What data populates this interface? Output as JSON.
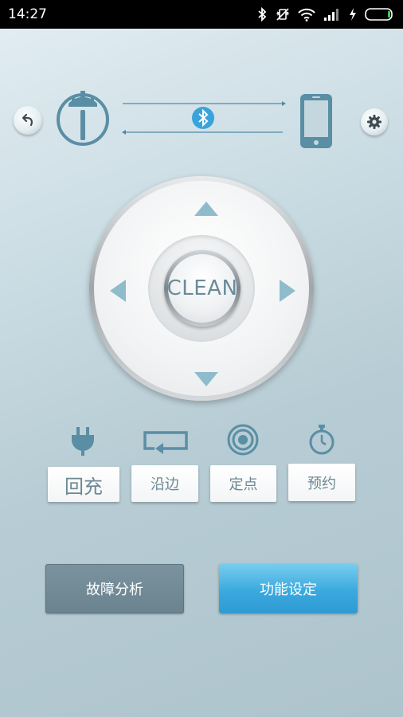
{
  "status_bar": {
    "time": "14:27",
    "icons": [
      "bluetooth-icon",
      "vibrate-icon",
      "wifi-icon",
      "signal-icon",
      "charging-icon",
      "battery-icon"
    ]
  },
  "connection": {
    "back_icon": "back-arrow-icon",
    "robot_icon": "robot-vacuum-icon",
    "link_icon": "bluetooth-icon",
    "phone_icon": "smartphone-icon",
    "settings_icon": "gear-icon"
  },
  "dpad": {
    "center_label": "CLEAN",
    "arrows": [
      "up",
      "down",
      "left",
      "right"
    ]
  },
  "modes": [
    {
      "icon": "plug-icon",
      "label": "回充"
    },
    {
      "icon": "edge-return-icon",
      "label": "沿边"
    },
    {
      "icon": "target-icon",
      "label": "定点"
    },
    {
      "icon": "stopwatch-icon",
      "label": "预约"
    }
  ],
  "actions": {
    "fault_label": "故障分析",
    "function_label": "功能设定"
  },
  "colors": {
    "accent": "#5a8ea4",
    "arrow": "#8fbccb",
    "primary_button": "#3aa9de",
    "secondary_button": "#6f8792",
    "bluetooth": "#3ba3dc"
  }
}
